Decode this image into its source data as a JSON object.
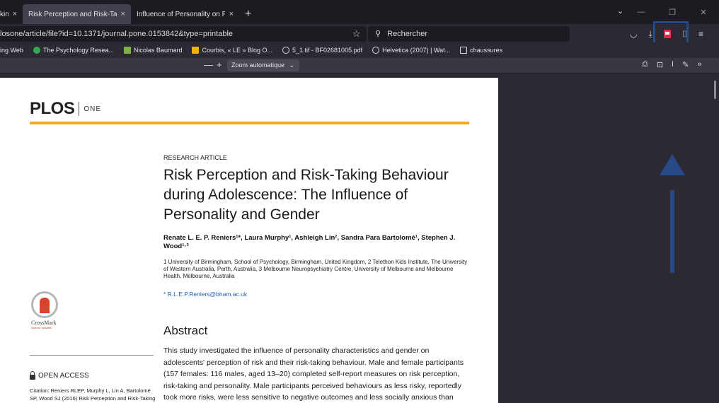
{
  "tabs": [
    {
      "label": "king",
      "close": "×"
    },
    {
      "label": "Risk Perception and Risk-Taking Beh",
      "close": "×"
    },
    {
      "label": "Influence of Personality on Percepti",
      "close": "×"
    }
  ],
  "new_tab": "+",
  "url": "losone/article/file?id=10.1371/journal.pone.0153842&type=printable",
  "search_placeholder": "Rechercher",
  "bookmarks": [
    {
      "label": "ing Web",
      "icon": "page-icon",
      "color": "#9ca3af"
    },
    {
      "label": "The Psychology Resea...",
      "icon": "chrome-icon",
      "color": "#34a853"
    },
    {
      "label": "Nicolas Baumard",
      "icon": "scholar-icon",
      "color": "#7cb342"
    },
    {
      "label": "Courbis, « LE » Blog O...",
      "icon": "blog-icon",
      "color": "#f0b400"
    },
    {
      "label": "5_1.tif - BF02681005.pdf",
      "icon": "globe-icon",
      "color": "#d8d8de"
    },
    {
      "label": "Helvetica (2007) | Wat...",
      "icon": "globe-icon",
      "color": "#d8d8de"
    },
    {
      "label": "chaussures",
      "icon": "folder-icon",
      "color": "#d8d8de"
    }
  ],
  "pdf_toolbar": {
    "zoom_out": "—",
    "zoom_in": "+",
    "zoom_label": "Zoom automatique"
  },
  "document": {
    "logo": "PLOS",
    "logo_sub": "ONE",
    "article_type": "RESEARCH ARTICLE",
    "title": "Risk Perception and Risk-Taking Behaviour during Adolescence: The Influence of Personality and Gender",
    "authors": "Renate L. E. P. Reniers¹*, Laura Murphy¹, Ashleigh Lin², Sandra Para Bartolomé¹, Stephen J. Wood¹·³",
    "affiliations": "1 University of Birmingham, School of Psychology, Birmingham, United Kingdom, 2 Telethon Kids Institute, The University of Western Australia, Perth, Australia, 3 Melbourne Neuropsychiatry Centre, University of Melbourne and Melbourne Health, Melbourne, Australia",
    "email": "* R.L.E.P.Reniers@bham.ac.uk",
    "crossmark_label": "CrossMark",
    "crossmark_sub": "click for updates",
    "abstract_heading": "Abstract",
    "abstract_text": "This study investigated the influence of personality characteristics and gender on adolescents' perception of risk and their risk-taking behaviour. Male and female participants (157 females: 116 males, aged 13–20) completed self-report measures on risk perception, risk-taking and personality. Male participants perceived behaviours as less risky, reportedly took more risks, were less sensitive to negative outcomes and less socially anxious than female participants. Both analysis identified a model in which age, behavioural inhibition",
    "open_access": "OPEN ACCESS",
    "citation": "Citation: Reniers RLEP, Murphy L, Lin A, Bartolomé SP, Wood SJ (2016) Risk Perception and Risk-Taking"
  }
}
